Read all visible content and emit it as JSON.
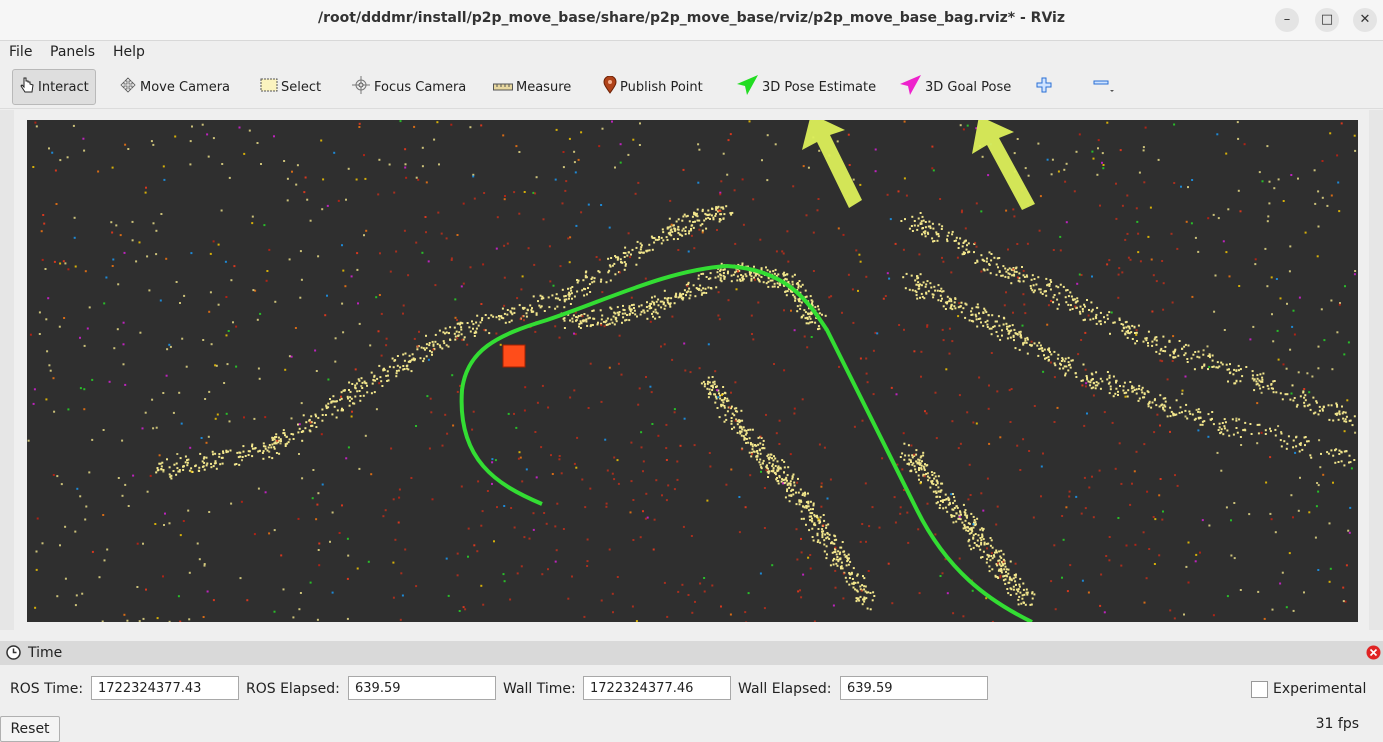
{
  "window": {
    "title": "/root/dddmr/install/p2p_move_base/share/p2p_move_base/rviz/p2p_move_base_bag.rviz* - RViz",
    "minimize": "–",
    "maximize": "□",
    "close": "✕"
  },
  "menu": [
    "File",
    "Panels",
    "Help"
  ],
  "toolbar": {
    "interact": "Interact",
    "move_camera": "Move Camera",
    "select": "Select",
    "focus_camera": "Focus Camera",
    "measure": "Measure",
    "publish_point": "Publish Point",
    "pose_estimate": "3D Pose Estimate",
    "goal_pose": "3D Goal Pose",
    "add_icon": "plus-icon",
    "remove_icon": "minus-icon"
  },
  "colors": {
    "viewport_bg": "#2f2f2f",
    "cloud_yellow": "#f2e68c",
    "path_green": "#33dd33",
    "arrow_green": "#dcef5a",
    "pose_estimate_icon": "#22dd22",
    "goal_pose_icon": "#ee22cc"
  },
  "time_panel": {
    "title": "Time",
    "ros_time_label": "ROS Time:",
    "ros_time": "1722324377.43",
    "ros_elapsed_label": "ROS Elapsed:",
    "ros_elapsed": "639.59",
    "wall_time_label": "Wall Time:",
    "wall_time": "1722324377.46",
    "wall_elapsed_label": "Wall Elapsed:",
    "wall_elapsed": "639.59",
    "experimental_label": "Experimental"
  },
  "footer": {
    "reset": "Reset",
    "fps": "31 fps"
  }
}
